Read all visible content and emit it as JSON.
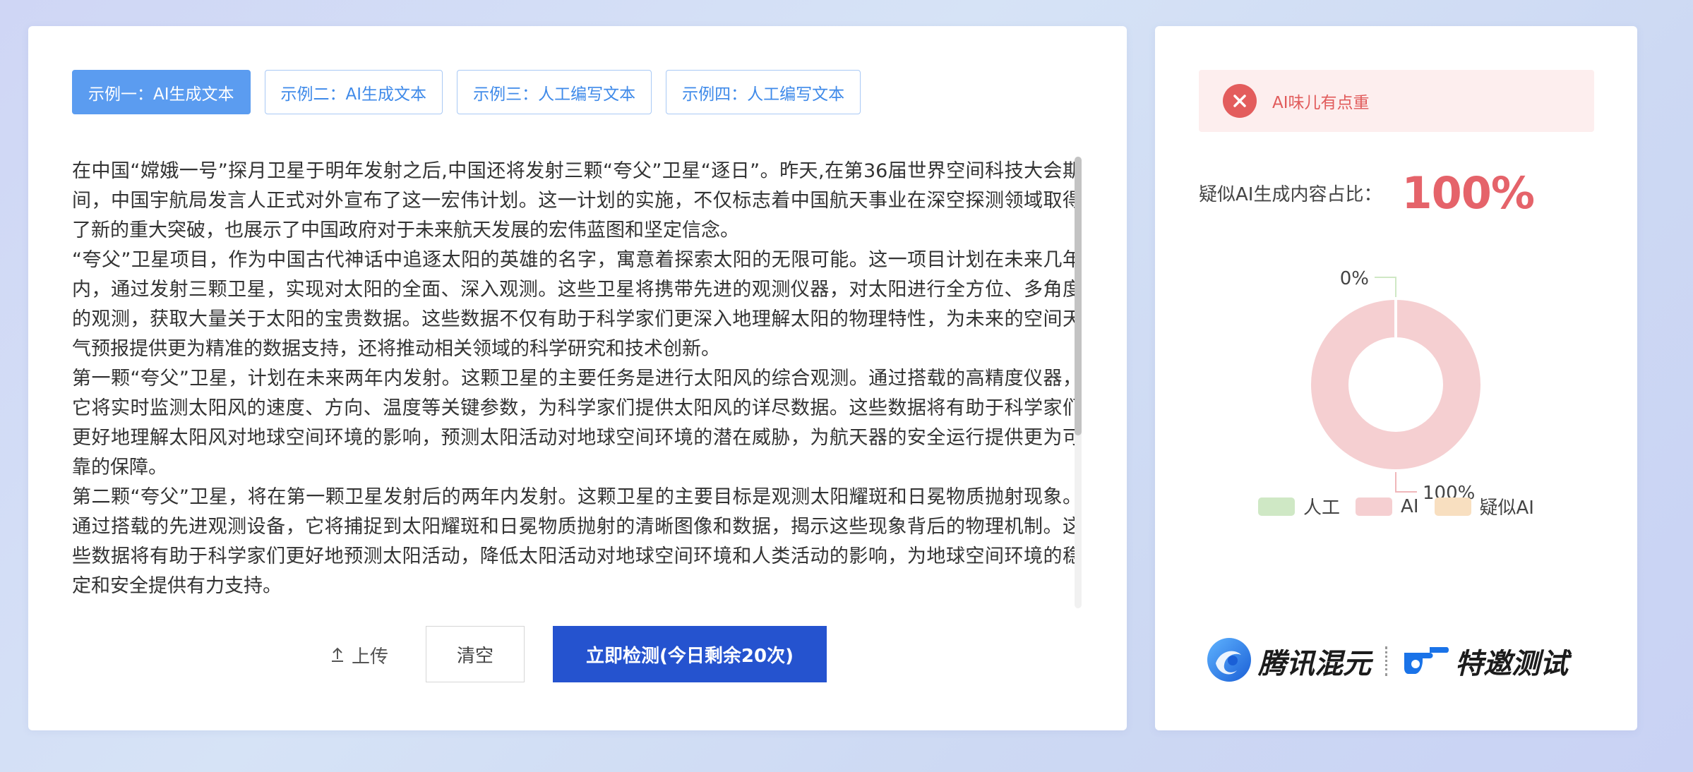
{
  "tabs": [
    {
      "label": "示例一：AI生成文本",
      "active": true
    },
    {
      "label": "示例二：AI生成文本",
      "active": false
    },
    {
      "label": "示例三：人工编写文本",
      "active": false
    },
    {
      "label": "示例四：人工编写文本",
      "active": false
    }
  ],
  "editor": {
    "paragraphs": [
      "在中国“嫦娥一号”探月卫星于明年发射之后,中国还将发射三颗“夸父”卫星“逐日”。昨天,在第36届世界空间科技大会期间，中国宇航局发言人正式对外宣布了这一宏伟计划。这一计划的实施，不仅标志着中国航天事业在深空探测领域取得了新的重大突破，也展示了中国政府对于未来航天发展的宏伟蓝图和坚定信念。",
      "“夸父”卫星项目，作为中国古代神话中追逐太阳的英雄的名字，寓意着探索太阳的无限可能。这一项目计划在未来几年内，通过发射三颗卫星，实现对太阳的全面、深入观测。这些卫星将携带先进的观测仪器，对太阳进行全方位、多角度的观测，获取大量关于太阳的宝贵数据。这些数据不仅有助于科学家们更深入地理解太阳的物理特性，为未来的空间天气预报提供更为精准的数据支持，还将推动相关领域的科学研究和技术创新。",
      "第一颗“夸父”卫星，计划在未来两年内发射。这颗卫星的主要任务是进行太阳风的综合观测。通过搭载的高精度仪器，它将实时监测太阳风的速度、方向、温度等关键参数，为科学家们提供太阳风的详尽数据。这些数据将有助于科学家们更好地理解太阳风对地球空间环境的影响，预测太阳活动对地球空间环境的潜在威胁，为航天器的安全运行提供更为可靠的保障。",
      "第二颗“夸父”卫星，将在第一颗卫星发射后的两年内发射。这颗卫星的主要目标是观测太阳耀斑和日冕物质抛射现象。通过搭载的先进观测设备，它将捕捉到太阳耀斑和日冕物质抛射的清晰图像和数据，揭示这些现象背后的物理机制。这些数据将有助于科学家们更好地预测太阳活动，降低太阳活动对地球空间环境和人类活动的影响，为地球空间环境的稳定和安全提供有力支持。"
    ]
  },
  "actions": {
    "upload_label": "上传",
    "clear_label": "清空",
    "detect_label": "立即检测(今日剩余20次)"
  },
  "result": {
    "alert_text": "AI味儿有点重",
    "ratio_label": "疑似AI生成内容占比：",
    "ratio_value": "100%"
  },
  "chart_data": {
    "type": "pie",
    "donut": true,
    "categories": [
      "人工",
      "AI",
      "疑似AI"
    ],
    "values": [
      0,
      100,
      0
    ],
    "colors": [
      "#cfe8c5",
      "#f5cfd1",
      "#f8dfc0"
    ],
    "data_labels": [
      "0%",
      "100%"
    ],
    "legend": "bottom"
  },
  "brand": {
    "name": "腾讯混元",
    "tag": "特邀测试",
    "logo_color": "#1a73e8"
  }
}
